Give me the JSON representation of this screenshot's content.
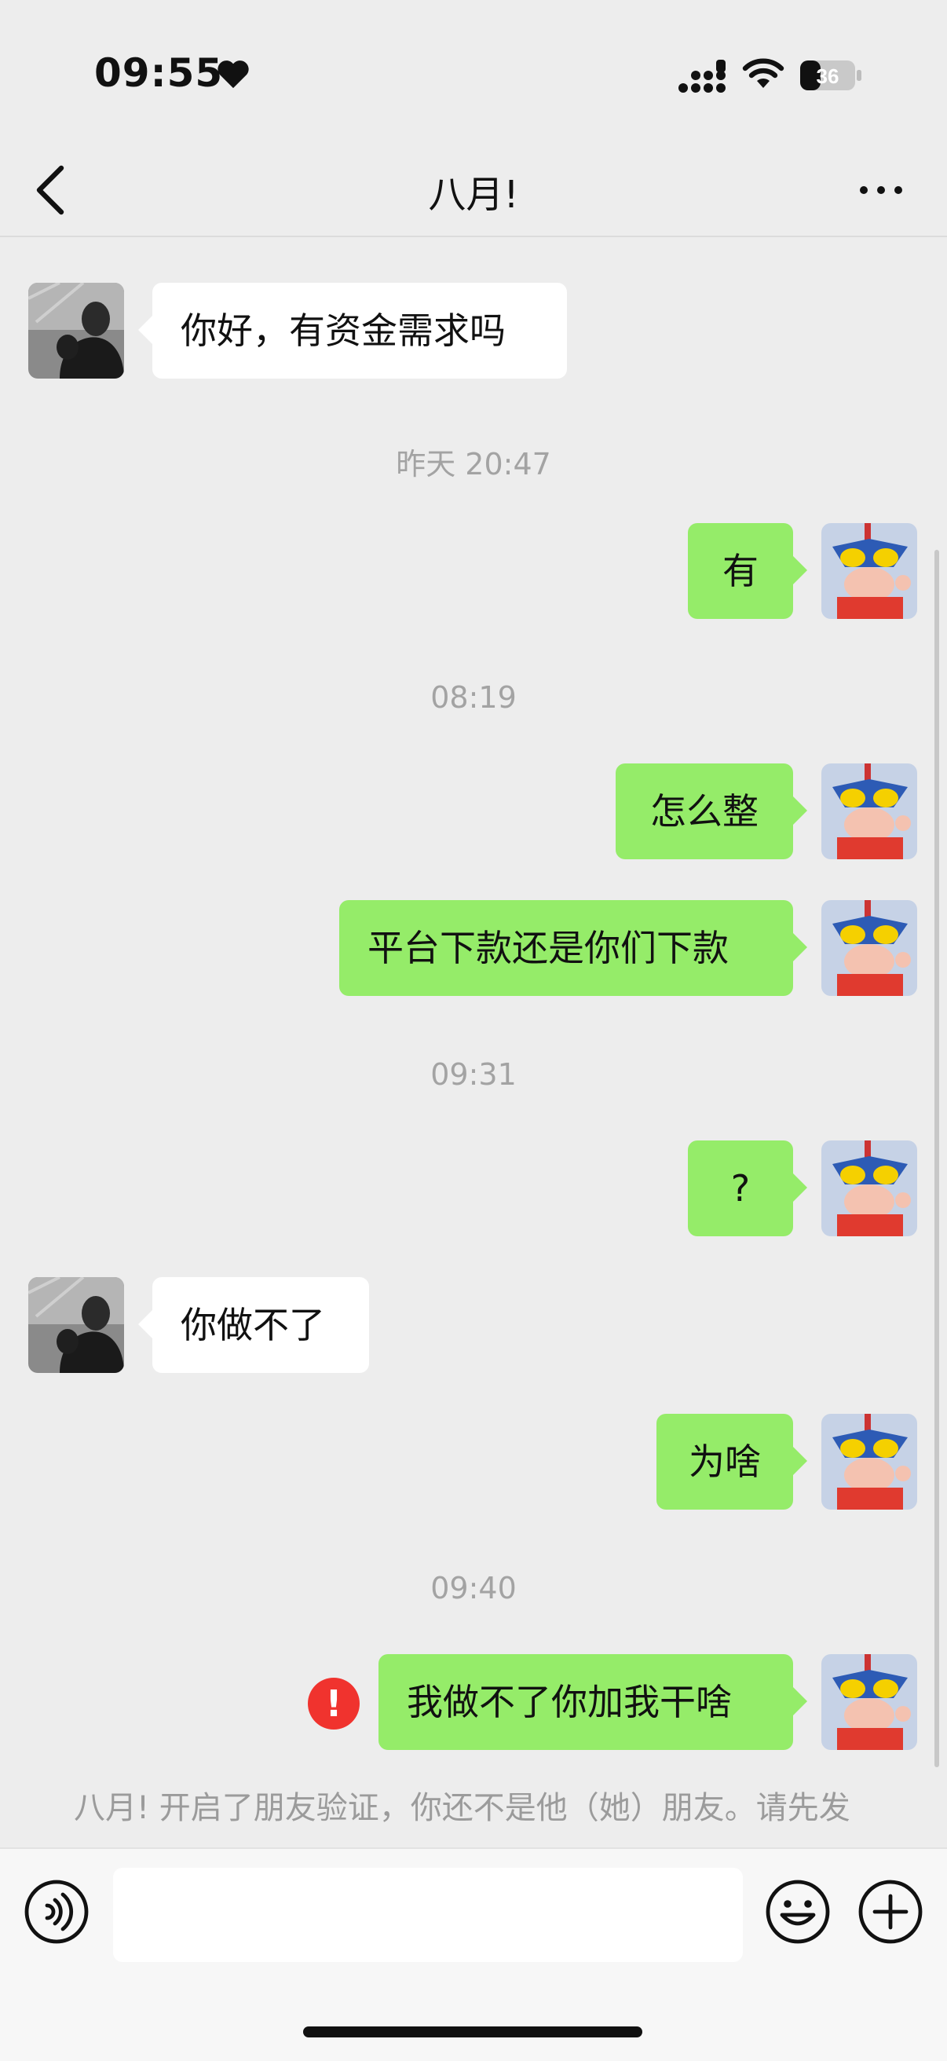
{
  "status": {
    "time": "09:55",
    "battery": "36"
  },
  "nav": {
    "title": "八月!"
  },
  "messages": {
    "m1": "你好，有资金需求吗",
    "ts1": "昨天 20:47",
    "m2": "有",
    "ts2": "08:19",
    "m3": "怎么整",
    "m4": "平台下款还是你们下款",
    "ts3": "09:31",
    "m5": "?",
    "m6": "你做不了",
    "m7": "为啥",
    "ts4": "09:40",
    "m8": "我做不了你加我干啥",
    "error": "!"
  },
  "system_notice": "八月! 开启了朋友验证，你还不是他（她）朋友。请先发",
  "icons": [
    "heart-icon",
    "signal-icon",
    "wifi-icon",
    "battery-icon",
    "back-icon",
    "more-icon",
    "voice-icon",
    "emoji-icon",
    "plus-icon"
  ],
  "colors": {
    "background": "#ededed",
    "outgoing_bubble": "#95ec69",
    "incoming_bubble": "#ffffff",
    "error": "#f0332e"
  }
}
